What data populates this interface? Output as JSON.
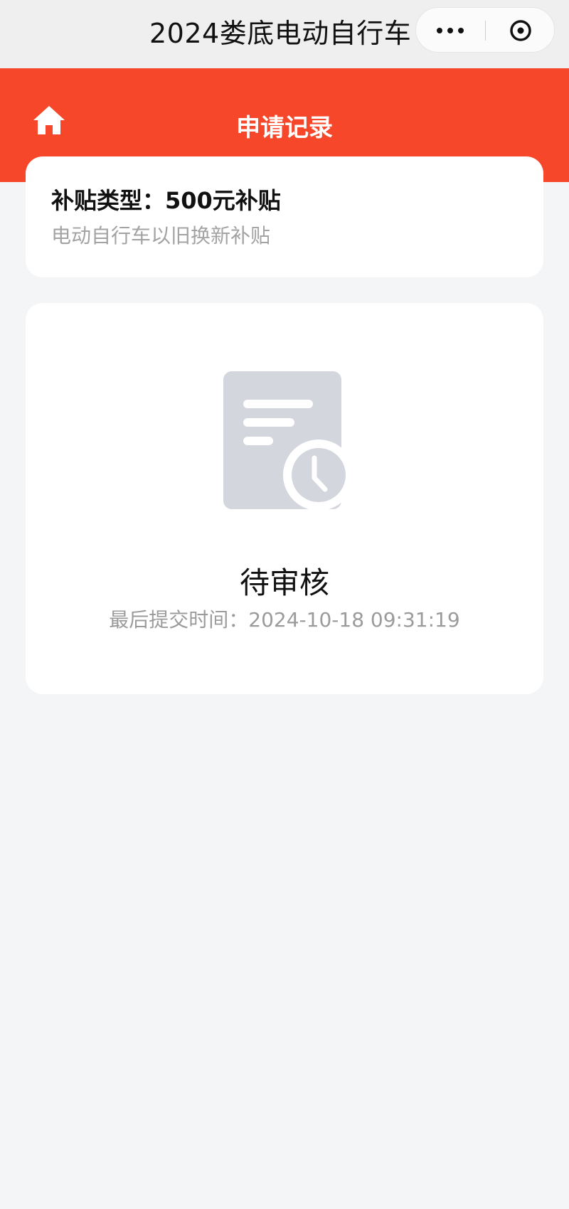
{
  "app": {
    "title": "2024娄底电动自行车"
  },
  "capsule": {
    "more_icon": "more-dots-icon",
    "close_icon": "close-circle-icon"
  },
  "header": {
    "title": "申请记录",
    "home_icon": "home-icon",
    "color": "#f7472a"
  },
  "subsidy": {
    "type_label": "补贴类型：500元补贴",
    "description": "电动自行车以旧换新补贴"
  },
  "status": {
    "icon": "document-clock-icon",
    "label": "待审核",
    "last_submit": "最后提交时间：2024-10-18 09:31:19"
  }
}
